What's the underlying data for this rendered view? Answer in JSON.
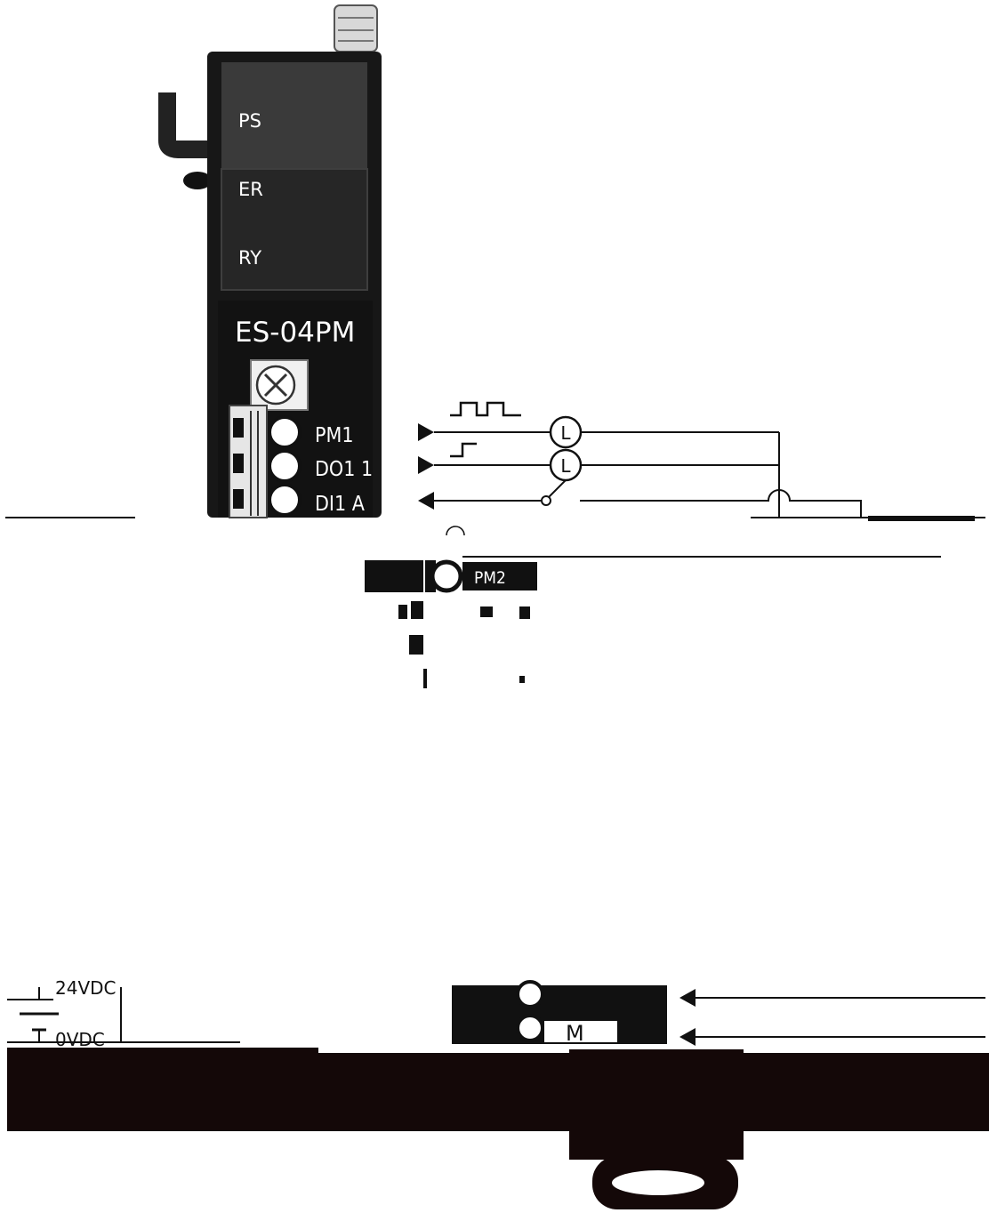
{
  "module": {
    "leds": [
      "PS",
      "ER",
      "RY"
    ],
    "model": "ES-04PM"
  },
  "terminals_upper": [
    "PM1",
    "DO1 1",
    "DI1 A"
  ],
  "terminal_lower": "PM2",
  "power": {
    "plus_label": "24VDC",
    "minus_label": "0VDC"
  },
  "load_symbol": "L",
  "motor_symbol": "M"
}
